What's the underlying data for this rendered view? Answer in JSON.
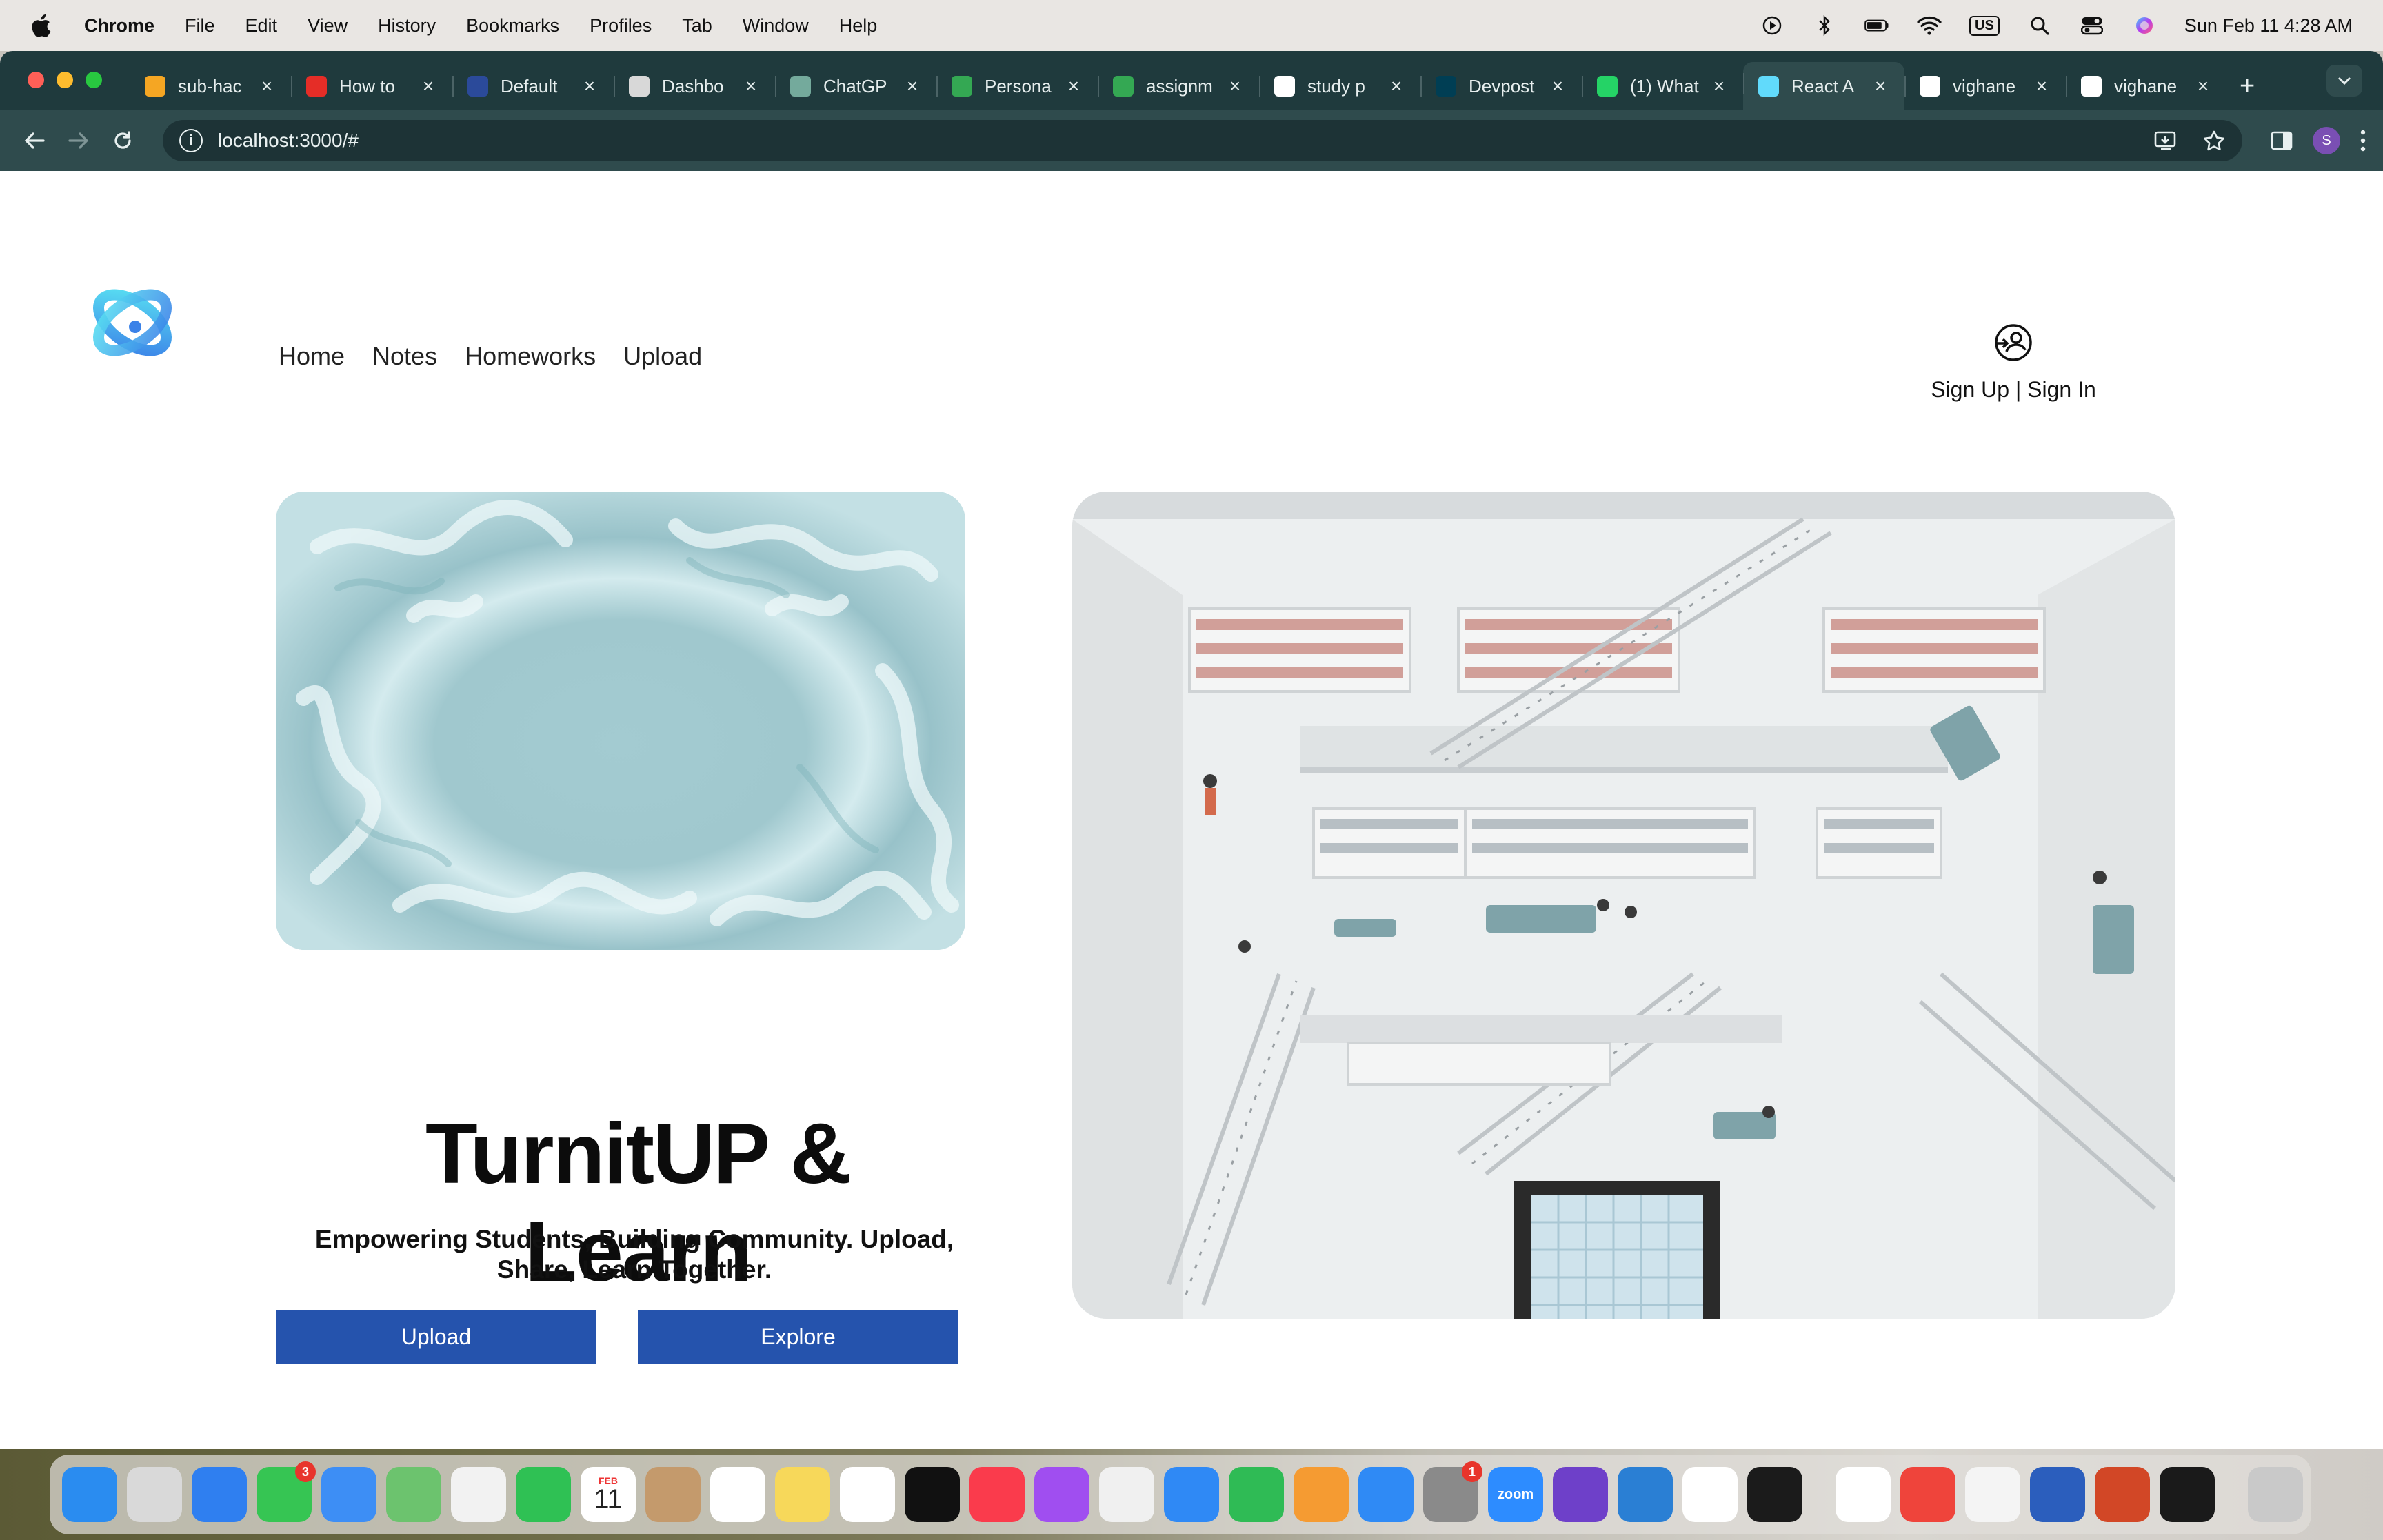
{
  "menubar": {
    "app": "Chrome",
    "items": [
      "File",
      "Edit",
      "View",
      "History",
      "Bookmarks",
      "Profiles",
      "Tab",
      "Window",
      "Help"
    ],
    "input_source": "US",
    "datetime": "Sun Feb 11  4:28 AM"
  },
  "tabs": [
    {
      "label": "sub-hac",
      "icon": "firebase-icon",
      "color": "#f5a623"
    },
    {
      "label": "How to",
      "icon": "youtube-icon",
      "color": "#e52d27"
    },
    {
      "label": "Default",
      "icon": "doc-icon",
      "color": "#2b4a9a"
    },
    {
      "label": "Dashbo",
      "icon": "dashboard-icon",
      "color": "#d8d8d8"
    },
    {
      "label": "ChatGP",
      "icon": "chatgpt-icon",
      "color": "#74aa9c"
    },
    {
      "label": "Persona",
      "icon": "drive-icon",
      "color": "#34a853"
    },
    {
      "label": "assignm",
      "icon": "drive-icon",
      "color": "#34a853"
    },
    {
      "label": "study p",
      "icon": "google-icon",
      "color": "#ffffff"
    },
    {
      "label": "Devpost",
      "icon": "devpost-icon",
      "color": "#003e54"
    },
    {
      "label": "(1) What",
      "icon": "whatsapp-icon",
      "color": "#25d366"
    },
    {
      "label": "React A",
      "icon": "react-icon",
      "color": "#61dafb"
    },
    {
      "label": "vighane",
      "icon": "github-icon",
      "color": "#ffffff"
    },
    {
      "label": "vighane",
      "icon": "github-icon",
      "color": "#ffffff"
    }
  ],
  "active_tab": 10,
  "address_bar": {
    "url": "localhost:3000/#"
  },
  "profile_initial": "S",
  "site": {
    "nav": [
      "Home",
      "Notes",
      "Homeworks",
      "Upload"
    ],
    "auth_label": "Sign Up | Sign In",
    "title": "TurnitUP & Learn",
    "subtitle": "Empowering Students, Building Community. Upload, Share, Learn Together.",
    "buttons": {
      "upload": "Upload",
      "explore": "Explore"
    },
    "accent": "#2553ad"
  },
  "dock": {
    "apps": [
      "Finder",
      "Launchpad",
      "Safari",
      "Messages",
      "Mail",
      "Maps",
      "Photos",
      "FaceTime",
      "Calendar",
      "Contacts",
      "Reminders",
      "Notes",
      "Freeform",
      "TV",
      "Music",
      "Podcasts",
      "News",
      "Keynote",
      "Numbers",
      "Pages",
      "App Store",
      "System Settings",
      "Zoom",
      "GitHub Desktop",
      "VS Code",
      "Chrome",
      "Record",
      "Acrobat",
      "AnyDesk",
      "TextEdit",
      "Word",
      "PowerPoint",
      "Terminal",
      "Trash"
    ],
    "calendar": {
      "month": "FEB",
      "day": "11"
    },
    "messages_badge": "3",
    "settings_badge": "1",
    "zoom_label": "zoom"
  }
}
